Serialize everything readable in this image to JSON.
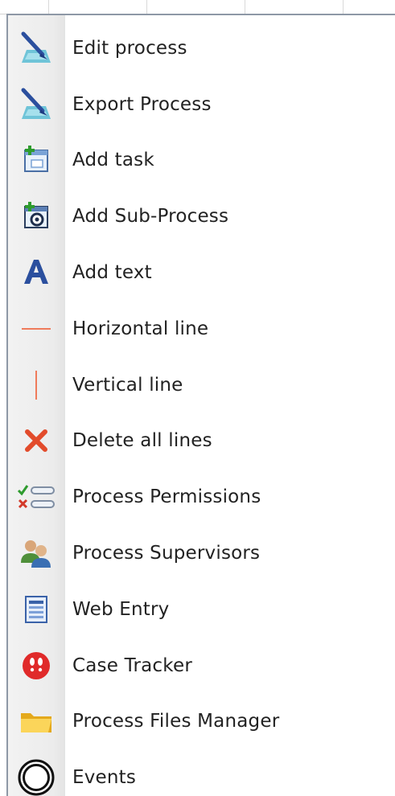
{
  "menu": {
    "items": [
      {
        "label": "Edit process",
        "icon": "edit-process-icon"
      },
      {
        "label": "Export Process",
        "icon": "export-process-icon"
      },
      {
        "label": "Add task",
        "icon": "add-task-icon"
      },
      {
        "label": "Add Sub-Process",
        "icon": "add-subprocess-icon"
      },
      {
        "label": "Add text",
        "icon": "add-text-icon"
      },
      {
        "label": "Horizontal line",
        "icon": "horizontal-line-icon"
      },
      {
        "label": "Vertical line",
        "icon": "vertical-line-icon"
      },
      {
        "label": "Delete all lines",
        "icon": "delete-lines-icon"
      },
      {
        "label": "Process Permissions",
        "icon": "permissions-icon"
      },
      {
        "label": "Process Supervisors",
        "icon": "supervisors-icon"
      },
      {
        "label": "Web Entry",
        "icon": "web-entry-icon"
      },
      {
        "label": "Case Tracker",
        "icon": "case-tracker-icon"
      },
      {
        "label": "Process Files Manager",
        "icon": "folder-icon"
      },
      {
        "label": "Events",
        "icon": "events-icon"
      }
    ]
  },
  "colors": {
    "accent_red": "#e65b3a",
    "icon_blue": "#2b4f9e",
    "text": "#222222"
  }
}
